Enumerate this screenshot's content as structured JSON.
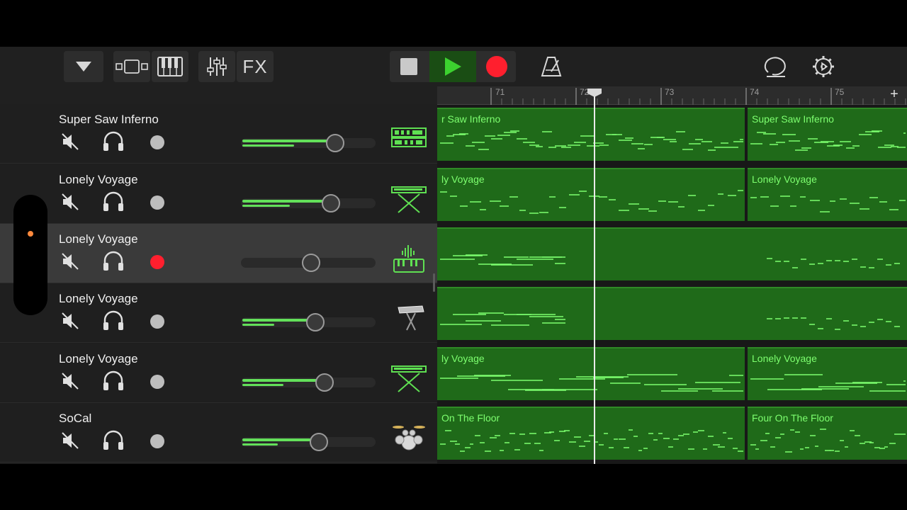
{
  "toolbar": {
    "browser_icon": "triangle-down-icon",
    "tracks_view_icon": "tracks-view-icon",
    "keyboard_icon": "piano-keys-icon",
    "mixer_icon": "mixer-sliders-icon",
    "fx_label": "FX",
    "stop_icon": "stop-icon",
    "play_icon": "play-icon",
    "record_icon": "record-icon",
    "metronome_icon": "metronome-icon",
    "loop_icon": "loop-browser-icon",
    "settings_icon": "gear-icon"
  },
  "colors": {
    "region_green": "#1f6a19",
    "note_green": "#7dff6f",
    "record_red": "#ff1f2e",
    "play_green": "#3cd12f"
  },
  "ruler": {
    "labels": [
      "71",
      "72",
      "73",
      "74",
      "75"
    ],
    "add_button": "+"
  },
  "tracks": [
    {
      "name": "Super Saw Inferno",
      "volume": 0.7,
      "armed": false,
      "instrument_icon": "synth-rack-icon",
      "selected": false
    },
    {
      "name": "Lonely Voyage",
      "volume": 0.67,
      "armed": false,
      "instrument_icon": "keyboard-stand-icon",
      "selected": false
    },
    {
      "name": "Lonely Voyage",
      "volume": 0.52,
      "armed": true,
      "instrument_icon": "smart-keyboard-icon",
      "selected": true
    },
    {
      "name": "Lonely Voyage",
      "volume": 0.55,
      "armed": false,
      "instrument_icon": "synth-stand-icon",
      "selected": false
    },
    {
      "name": "Lonely Voyage",
      "volume": 0.62,
      "armed": false,
      "instrument_icon": "keyboard-stand-icon",
      "selected": false
    },
    {
      "name": "SoCal",
      "volume": 0.58,
      "armed": false,
      "instrument_icon": "drum-kit-icon",
      "selected": false
    }
  ],
  "regions": {
    "r1a": "r Saw Inferno",
    "r1b": "Super Saw Inferno",
    "r2a": "ly Voyage",
    "r2b": "Lonely Voyage",
    "r5a": "ly Voyage",
    "r5b": "Lonely Voyage",
    "r6a": "On The Floor",
    "r6b": "Four On The Floor"
  }
}
